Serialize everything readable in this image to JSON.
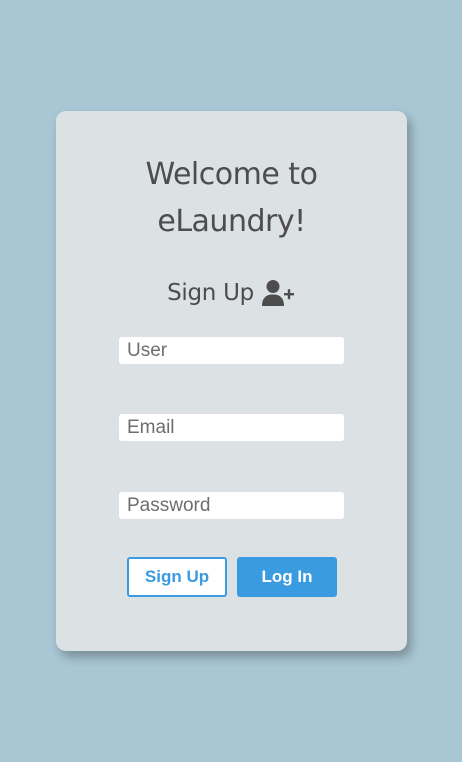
{
  "title": {
    "line1": "Welcome to",
    "line2": "eLaundry!"
  },
  "form_heading": {
    "label": "Sign Up",
    "icon": "user-plus-icon"
  },
  "fields": {
    "user_placeholder": "User",
    "email_placeholder": "Email",
    "password_placeholder": "Password"
  },
  "buttons": {
    "signup_label": "Sign Up",
    "login_label": "Log In"
  },
  "colors": {
    "background": "#a9c6d4",
    "card": "#dce1e4",
    "text": "#4d4d4d",
    "accent": "#3a9be1"
  }
}
